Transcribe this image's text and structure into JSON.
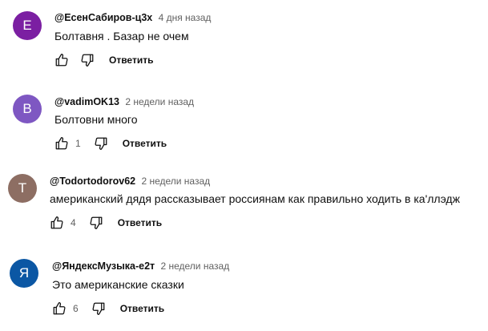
{
  "comments": [
    {
      "avatar_letter": "Е",
      "avatar_color": "#7b1fa2",
      "author": "@ЕсенСабиров-ц3х",
      "time": "4 дня назад",
      "text": "Болтавня . Базар не очем",
      "likes": "",
      "reply_label": "Ответить"
    },
    {
      "avatar_letter": "B",
      "avatar_color": "#7e57c2",
      "author": "@vadimOK13",
      "time": "2 недели назад",
      "text": "Болтовни много",
      "likes": "1",
      "reply_label": "Ответить"
    },
    {
      "avatar_letter": "T",
      "avatar_color": "#8d6e63",
      "author": "@Todortodorov62",
      "time": "2 недели назад",
      "text": "американский дядя рассказывает россиянам как правильно ходить в ка'ллэдж",
      "likes": "4",
      "reply_label": "Ответить"
    },
    {
      "avatar_letter": "Я",
      "avatar_color": "#0b57a4",
      "author": "@ЯндексМузыка-е2т",
      "time": "2 недели назад",
      "text": "Это американские сказки",
      "likes": "6",
      "reply_label": "Ответить"
    }
  ],
  "icons": {
    "like": "thumb-up-icon",
    "dislike": "thumb-down-icon"
  }
}
